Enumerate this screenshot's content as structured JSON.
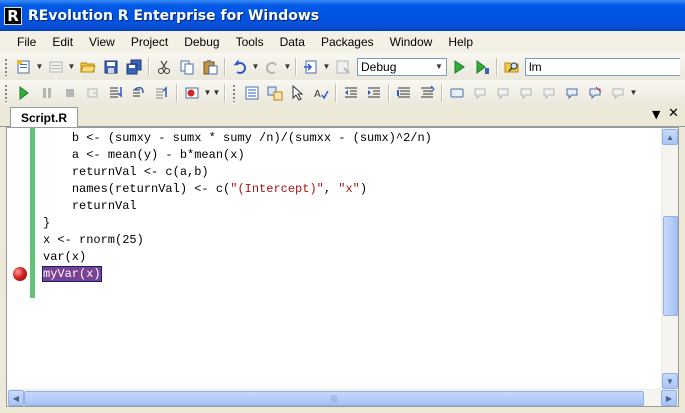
{
  "window": {
    "title": "REvolution R Enterprise for Windows",
    "logo": "R"
  },
  "menu": [
    "File",
    "Edit",
    "View",
    "Project",
    "Debug",
    "Tools",
    "Data",
    "Packages",
    "Window",
    "Help"
  ],
  "toolbar": {
    "configuration_value": "Debug",
    "find_value": "lm",
    "icons": [
      "new-project-icon",
      "add-item-icon",
      "open-icon",
      "save-icon",
      "save-all-icon",
      "cut-icon",
      "copy-icon",
      "paste-icon",
      "undo-icon",
      "redo-icon",
      "navigate-icon",
      "run-icon",
      "run-to-cursor-icon",
      "find-in-files-icon"
    ]
  },
  "tabs": [
    {
      "label": "Script.R",
      "active": true
    }
  ],
  "editor": {
    "lines": [
      {
        "indent": "    ",
        "parts": [
          [
            "b <- (sumxy - sumx * sumy /n)/(sumxx - (sumx)^2/n)",
            "plain"
          ]
        ]
      },
      {
        "indent": "    ",
        "parts": [
          [
            "a <- mean(y) - b*mean(x)",
            "plain"
          ]
        ]
      },
      {
        "indent": "    ",
        "parts": [
          [
            "returnVal <- c(a,b)",
            "plain"
          ]
        ]
      },
      {
        "indent": "    ",
        "parts": [
          [
            "names(returnVal) <- c(",
            "plain"
          ],
          [
            "\"(Intercept)\"",
            "str"
          ],
          [
            ", ",
            "plain"
          ],
          [
            "\"x\"",
            "str"
          ],
          [
            ")",
            "plain"
          ]
        ]
      },
      {
        "indent": "    ",
        "parts": [
          [
            "returnVal",
            "plain"
          ]
        ]
      },
      {
        "indent": "",
        "parts": [
          [
            "}",
            "plain"
          ]
        ]
      },
      {
        "indent": "",
        "parts": [
          [
            "x <- rnorm(25)",
            "plain"
          ]
        ]
      },
      {
        "indent": "",
        "parts": [
          [
            "var(x)",
            "plain"
          ]
        ]
      },
      {
        "indent": "",
        "parts": [
          [
            "myVar(x)",
            "hl"
          ]
        ],
        "breakpoint": true
      }
    ]
  },
  "colors": {
    "title_bar": "#0054e3",
    "string": "#a31515",
    "breakpoint": "#d42424",
    "highlight": "#7a4194",
    "change_bar": "#63c37b"
  }
}
